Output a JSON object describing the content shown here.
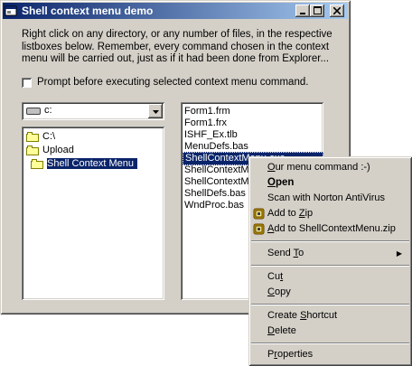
{
  "window": {
    "title": "Shell context menu demo",
    "buttons": {
      "minimize": "_",
      "maximize": "□",
      "close": "×"
    }
  },
  "description": "Right click on any directory, or any number of files, in the respective listboxes below. Remember, every command chosen in the context menu will be carried out, just as if it had been done from Explorer...",
  "prompt_checkbox": {
    "label": "Prompt before executing selected context menu command.",
    "checked": false
  },
  "drive": {
    "value": "c:",
    "dropdown_icon": "triangle-down-icon"
  },
  "directories": [
    {
      "label": "C:\\",
      "selected": false
    },
    {
      "label": "Upload",
      "selected": false
    },
    {
      "label": "Shell Context Menu",
      "selected": true
    }
  ],
  "files": [
    {
      "label": "Form1.frm",
      "selected": false
    },
    {
      "label": "Form1.frx",
      "selected": false
    },
    {
      "label": "ISHF_Ex.tlb",
      "selected": false
    },
    {
      "label": "MenuDefs.bas",
      "selected": false
    },
    {
      "label": "ShellContextMenu.exe",
      "selected": true
    },
    {
      "label": "ShellContextM",
      "selected": false
    },
    {
      "label": "ShellContextM",
      "selected": false
    },
    {
      "label": "ShellDefs.bas",
      "selected": false
    },
    {
      "label": "WndProc.bas",
      "selected": false
    }
  ],
  "context_menu": {
    "items": [
      {
        "label": "Our menu command :-)",
        "accel": "O"
      },
      {
        "label": "Open",
        "accel": "O",
        "bold": true
      },
      {
        "label": "Scan with Norton AntiVirus",
        "accel": ""
      },
      {
        "label": "Add to Zip",
        "accel": "Z",
        "icon": "winzip-icon"
      },
      {
        "label": "Add to ShellContextMenu.zip",
        "accel": "A",
        "icon": "winzip-icon"
      },
      {
        "label": "Send To",
        "accel": "T",
        "submenu": true
      },
      {
        "label": "Cut",
        "accel": "t"
      },
      {
        "label": "Copy",
        "accel": "C"
      },
      {
        "label": "Create Shortcut",
        "accel": "S"
      },
      {
        "label": "Delete",
        "accel": "D"
      },
      {
        "label": "Properties",
        "accel": "r"
      }
    ]
  },
  "colors": {
    "face": "#d4d0c8",
    "title_start": "#0a246a",
    "title_end": "#a6caf0",
    "selection": "#0a246a"
  }
}
